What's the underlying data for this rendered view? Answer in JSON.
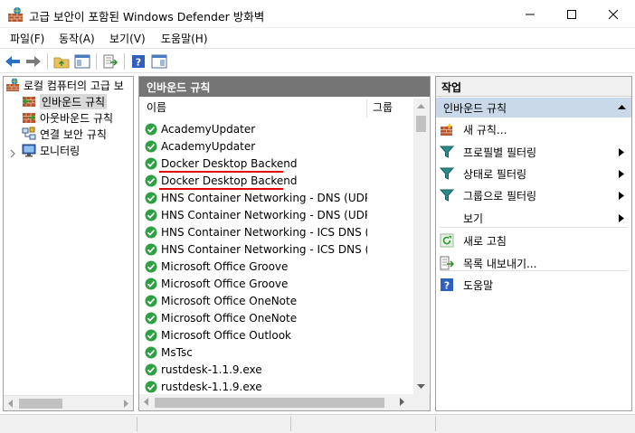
{
  "window": {
    "title": "고급 보안이 포함된 Windows Defender 방화벽",
    "controls": [
      "minimize",
      "maximize",
      "close"
    ]
  },
  "menu": [
    "파일(F)",
    "동작(A)",
    "보기(V)",
    "도움말(H)"
  ],
  "toolbar": {
    "icons": [
      "back-arrow-icon",
      "forward-arrow-icon",
      "up-folder-icon",
      "show-hide-tree-icon",
      "export-list-icon",
      "help-icon",
      "show-hide-action-pane-icon"
    ]
  },
  "tree": {
    "root": "로컬 컴퓨터의 고급 보",
    "items": [
      {
        "label": "인바운드 규칙",
        "selected": true,
        "icon": "inbound-rules-icon"
      },
      {
        "label": "아웃바운드 규칙",
        "selected": false,
        "icon": "outbound-rules-icon"
      },
      {
        "label": "연결 보안 규칙",
        "selected": false,
        "icon": "connection-security-icon"
      },
      {
        "label": "모니터링",
        "selected": false,
        "icon": "monitor-icon"
      }
    ]
  },
  "rules_pane": {
    "title": "인바운드 규칙",
    "columns": {
      "name": "이름",
      "group": "그룹"
    },
    "rows": [
      "AcademyUpdater",
      "AcademyUpdater",
      "Docker Desktop Backend",
      "Docker Desktop Backend",
      "HNS Container Networking - DNS (UDP...",
      "HNS Container Networking - DNS (UDP...",
      "HNS Container Networking - ICS DNS (...",
      "HNS Container Networking - ICS DNS (...",
      "Microsoft Office Groove",
      "Microsoft Office Groove",
      "Microsoft Office OneNote",
      "Microsoft Office OneNote",
      "Microsoft Office Outlook",
      "MsTsc",
      "rustdesk-1.1.9.exe",
      "rustdesk-1.1.9.exe"
    ],
    "underlined_rows": [
      2,
      3
    ],
    "underline_color": "#e00000"
  },
  "actions_pane": {
    "title": "작업",
    "section": "인바운드 규칙",
    "items": [
      {
        "label": "새 규칙...",
        "icon": "new-rule-icon",
        "submenu": false
      },
      {
        "label": "프로필별 필터링",
        "icon": "filter-icon",
        "submenu": true
      },
      {
        "label": "상태로 필터링",
        "icon": "filter-icon",
        "submenu": true
      },
      {
        "label": "그룹으로 필터링",
        "icon": "filter-icon",
        "submenu": true
      },
      {
        "label": "보기",
        "icon": "",
        "submenu": true
      },
      {
        "label": "새로 고침",
        "icon": "refresh-icon",
        "submenu": false
      },
      {
        "label": "목록 내보내기...",
        "icon": "export-list-icon",
        "submenu": false
      },
      {
        "label": "도움말",
        "icon": "help-icon",
        "submenu": false
      }
    ]
  },
  "colors": {
    "rules_header_bg": "#757575",
    "actions_section_bg": "#c9d9ea",
    "enabled_check": "#2ea043"
  }
}
